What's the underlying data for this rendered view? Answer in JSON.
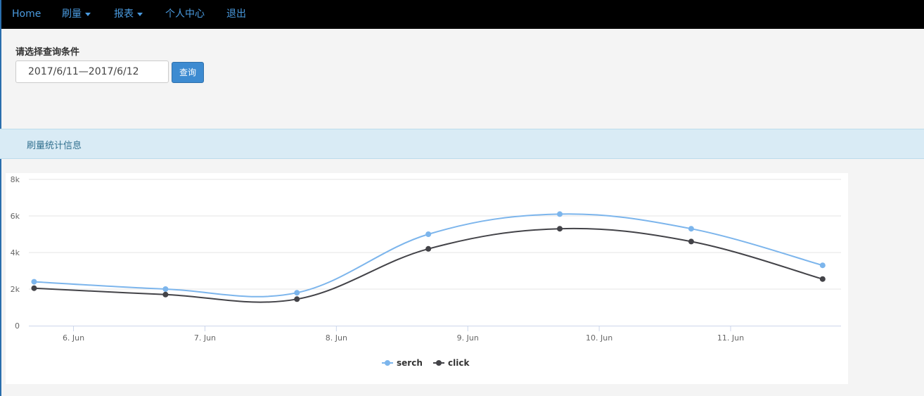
{
  "navbar": {
    "items": [
      {
        "label": "Home",
        "dropdown": false
      },
      {
        "label": "刷量",
        "dropdown": true
      },
      {
        "label": "报表",
        "dropdown": true
      },
      {
        "label": "个人中心",
        "dropdown": false
      },
      {
        "label": "退出",
        "dropdown": false
      }
    ],
    "colors": {
      "background": "#000000",
      "link": "#4a9be0"
    }
  },
  "query": {
    "label": "请选择查询条件",
    "date_range_value": "2017/6/11—2017/6/12",
    "button_label": "查询"
  },
  "panel": {
    "title": "刷量统计信息",
    "background": "#d9ebf5"
  },
  "chart_data": {
    "type": "line",
    "x": [
      "6. Jun",
      "7. Jun",
      "8. Jun",
      "9. Jun",
      "10. Jun",
      "11. Jun"
    ],
    "xlim": [
      5.66,
      11.84
    ],
    "ylim": [
      0,
      8000
    ],
    "y_ticks": [
      {
        "value": 0,
        "label": "0"
      },
      {
        "value": 2000,
        "label": "2k"
      },
      {
        "value": 4000,
        "label": "4k"
      },
      {
        "value": 6000,
        "label": "6k"
      },
      {
        "value": 8000,
        "label": "8k"
      }
    ],
    "x_ticks": [
      {
        "value": 6,
        "label": "6. Jun"
      },
      {
        "value": 7,
        "label": "7. Jun"
      },
      {
        "value": 8,
        "label": "8. Jun"
      },
      {
        "value": 9,
        "label": "9. Jun"
      },
      {
        "value": 10,
        "label": "10. Jun"
      },
      {
        "value": 11,
        "label": "11. Jun"
      }
    ],
    "series": [
      {
        "name": "serch",
        "color": "#7cb5ec",
        "points": [
          [
            5.7,
            2400
          ],
          [
            6.7,
            2000
          ],
          [
            7.7,
            1800
          ],
          [
            8.7,
            5000
          ],
          [
            9.7,
            6100
          ],
          [
            10.7,
            5300
          ],
          [
            11.7,
            3300
          ]
        ]
      },
      {
        "name": "click",
        "color": "#434348",
        "points": [
          [
            5.7,
            2050
          ],
          [
            6.7,
            1700
          ],
          [
            7.7,
            1450
          ],
          [
            8.7,
            4200
          ],
          [
            9.7,
            5300
          ],
          [
            10.7,
            4600
          ],
          [
            11.7,
            2550
          ]
        ]
      }
    ],
    "grid": true,
    "legend": "bottom-center"
  }
}
